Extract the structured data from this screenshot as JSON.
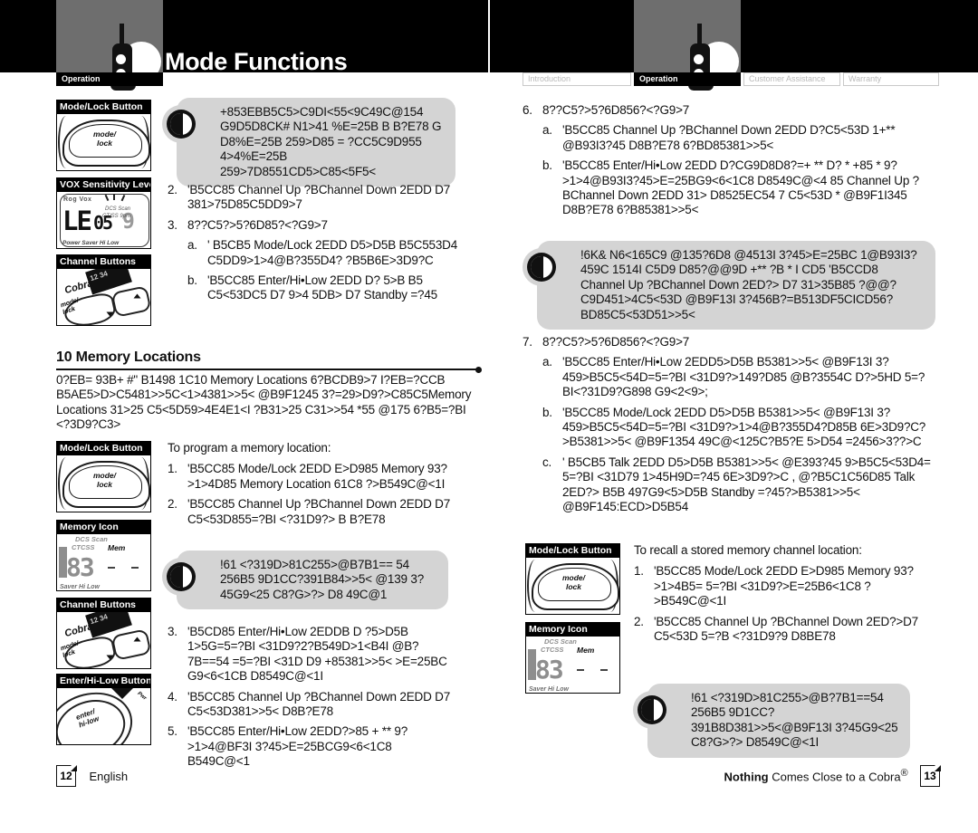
{
  "header": {
    "title": "Mode Functions",
    "left_tab_label": "Operation",
    "logo_name": "cobra-radio-logo"
  },
  "tabs": [
    {
      "label": "Introduction",
      "active": false
    },
    {
      "label": "Operation",
      "active": true
    },
    {
      "label": "Customer Assistance",
      "active": false
    },
    {
      "label": "Warranty",
      "active": false
    }
  ],
  "left_page": {
    "figures": [
      {
        "caption": "Mode/Lock Button",
        "art": "mode-lock",
        "label1": "mode/",
        "label2": "lock"
      },
      {
        "caption": "VOX Sensitivity Level",
        "art": "lcd-vox",
        "digits": "LE",
        "digits2": "05",
        "digits3": "9",
        "top": "Rog Vox",
        "sub1": "DCS  Scan",
        "sub2": "CT/SS  9pm",
        "bottom": "Power Saver  Hi Low"
      },
      {
        "caption": "Channel Buttons",
        "art": "channel-buttons",
        "brand": "Cobra",
        "label1": "mode/",
        "label2": "lock"
      },
      {
        "caption": "Mode/Lock Button",
        "art": "mode-lock",
        "label1": "mode/",
        "label2": "lock"
      },
      {
        "caption": "Memory Icon",
        "art": "memory-icon",
        "row1": "DCS  Scan",
        "row2": "CTCSS",
        "mem": "Mem",
        "digits": "83",
        "bottom": "Saver  Hi Low"
      },
      {
        "caption": "Channel Buttons",
        "art": "channel-buttons",
        "brand": "Cobra",
        "label1": "mode/",
        "label2": "lock"
      },
      {
        "caption": "Enter/Hi-Low Button",
        "art": "enter-hilow",
        "label1": "enter/",
        "label2": "hi-low",
        "pwr": "Pwr"
      }
    ],
    "tip1": "+853EBB5C5>C9DI<55<9C49C@154 G9D5D8CK# N1>41 %E=25B B B?E78  G D8%E=25B  259>D85 = ?CC5C9D955 4>4%E=25B 259>7D8551CD5>C85<5F5<",
    "item2": "'B5CC85 Channel Up ?BChannel Down 2EDD D7 381>75D85C5DD9>7",
    "item3_head": "8??C5?>5?6D85?<?G9>7",
    "item3a": "' B5CB5 Mode/Lock 2EDD D5>D5B B5C553D4 C5DD9>1>4@B?355D4? ?B5B6E>3D9?C",
    "item3b": "'B5CC85 Enter/Hi•Low 2EDD D? 5>B B5 C5<53DC5 D7 9>4 5DB> D7 Standby =?45",
    "section_title": "10 Memory Locations",
    "section_body": "0?EB= 93B+ #\" B1498 1C10 Memory Locations 6?BCDB9>7 I?EB=?CCB B5AE5>D>C5481>>5C<1>4381>>5< @B9F1245 3?=29>D9?>C85C5Memory Locations 31>25 C5<5D59>4E4E1<I ?B31>25 C31>>54 *55 @175 6?B5=?BI <?3D9?C3>",
    "lead1": "To program a memory location:",
    "p1": "'B5CC85 Mode/Lock 2EDD E>D985 Memory 93?>1>4D85 Memory Location 61C8 ?>B549C@<1I",
    "p2": "'B5CC85 Channel Up ?BChannel Down 2EDD D7 C5<53D855=?BI <?31D9?> B B?E78",
    "tip2": "!61 <?319D>81C255>@B7B1== 54 256B5 9D1CC?391B84>>5< @139 3?45G9<25 C8?G>?> D8 49C@1",
    "p3": "'B5CD85 Enter/Hi•Low 2EDDB D ?5>D5B 1>5G=5=?BI <31D9?2?B549D>1<B4I @B?7B==54 =5=?BI <31D D9 +85381>>5< >E=25BC G9<6<1CB D8549C@<1I",
    "p4": "'B5CC85 Channel Up ?BChannel Down 2EDD D7 C5<53D381>>5< D8B?E78",
    "p5": "'B5CC85 Enter/Hi•Low 2EDD?>85 +  ** 9?>1>4@BF3I 3?45>E=25BCG9<6<1C8 B549C@<1",
    "page_number": "12",
    "language": "English"
  },
  "right_page": {
    "item6_head": "8??C5?>5?6D856?<?G9>7",
    "item6a": "'B5CC85 Channel Up ?BChannel Down 2EDD D?C5<53D 1+** @B93I3?45  D8B?E78  6?BD85381>>5<",
    "item6b": "'B5CC85 Enter/Hi•Low 2EDD D?CG9D8D8?=+ ** D? *  +85  *  9?>1>4@B93I3?45>E=25BG9<6<1C8 D8549C@<4 85 Channel Up ?BChannel Down 2EDD 31> D8525EC54 7 C5<53D *  @B9F1I345  D8B?E78 6?B85381>>5<",
    "tip3": "!6K&  N6<165C9 @135?6D8 @4513I 3?45>E=25BC 1@B93I3?459C 1514I C5D9 D85?@@9D  +** ?B  *  I CD5 'B5CCD8 Channel Up ?BChannel Down 2ED?> D7 31>35B85 ?@@?C9D451>4C5<53D @B9F13I 3?456B?=B513DF5CICD56?BD85C5<53D51>>5<",
    "item7_head": "8??C5?>5?6D856?<?G9>7",
    "item7a": "'B5CC85 Enter/Hi•Low 2EDD5>D5B B5381>>5< @B9F13I 3?459>B5C5<54D=5=?BI <31D9?>149?D85 @B?3554C D?>5HD 5=?BI<?31D9?G898 G9<2<9>;",
    "item7b": "'B5CC85 Mode/Lock 2EDD D5>D5B B5381>>5< @B9F13I 3?459>B5C5<54D=5=?BI <31D9?>1>4@B?355D4?D85B 6E>3D9?C?>B5381>>5< @B9F1354 49C@<125C?B5?E 5>D54 =2456>3??>C",
    "item7c": "' B5CB5 Talk 2EDD D5>D5B B5381>>5< @E393?45 9>B5C5<53D4= 5=?BI <31D79 1>45H9D=?45 6E>3D9?>C , @?B5C1C56D85 Talk 2ED?> B5B 497G9<5>D5B Standby =?45?>B5381>>5< @B9F145:ECD>D5B54",
    "lead2": "To recall a stored memory channel location:",
    "r1": "'B5CC85 Mode/Lock 2EDD E>D985 Memory 93?>1>4B5= 5=?BI <31D9?>E=25B6<1C8 ?>B549C@<1I",
    "r2": "'B5CC85 Channel Up ?BChannel Down 2ED?>D7 C5<53D 5=?B <?31D9?9 D8BE78",
    "tip4": "!61 <?319D>81C255>@B?7B1==54 256B5 9D1CC?391B8D381>>5<@B9F13I 3?45G9<25 C8?G>?> D8549C@<1I",
    "tagline_bold": "Nothing",
    "tagline_rest": " Comes Close to a Cobra",
    "tagline_sup": "®",
    "page_number": "13"
  }
}
